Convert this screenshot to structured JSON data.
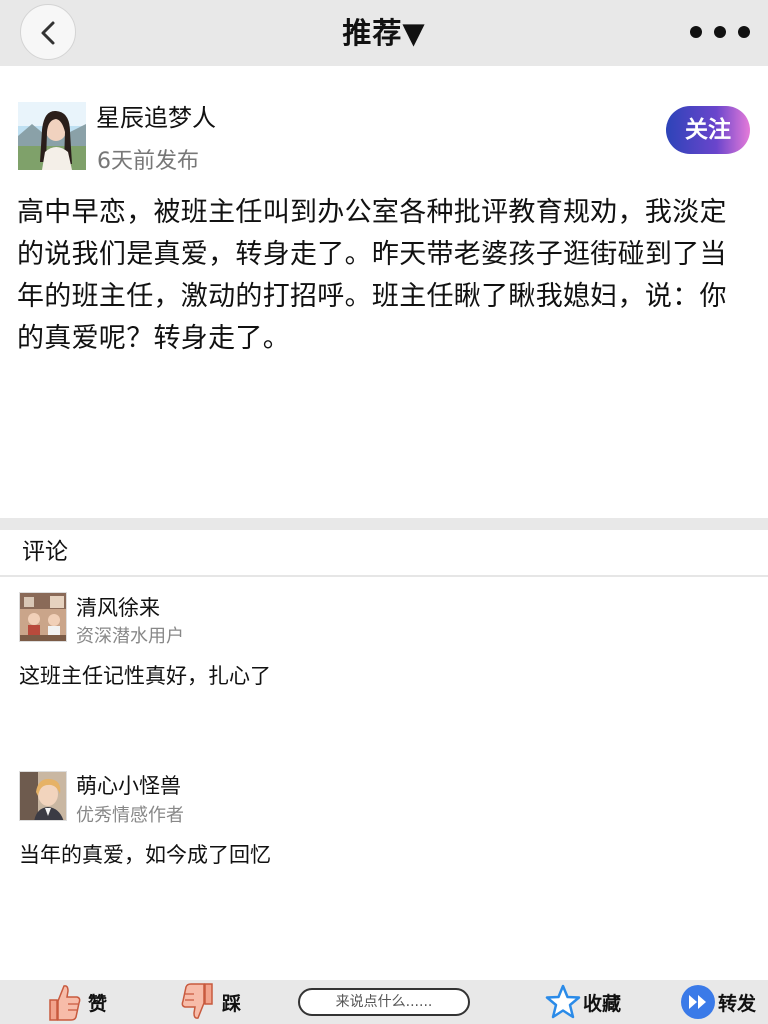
{
  "header": {
    "title": "推荐▼",
    "back_icon": "chevron-left-icon",
    "more_icon": "more-horizontal-icon"
  },
  "post": {
    "author": "星辰追梦人",
    "time": "6天前发布",
    "follow_label": "关注",
    "follow_gradient": [
      "#2d44b8",
      "#6a45cc",
      "#e57bd9"
    ],
    "body": "高中早恋，被班主任叫到办公室各种批评教育规劝，我淡定的说我们是真爱，转身走了。昨天带老婆孩子逛街碰到了当年的班主任，激动的打招呼。班主任瞅了瞅我媳妇，说：你的真爱呢？转身走了。"
  },
  "comments_section": {
    "heading": "评论",
    "items": [
      {
        "name": "清风徐来",
        "tag": "资深潜水用户",
        "text": "这班主任记性真好，扎心了"
      },
      {
        "name": "萌心小怪兽",
        "tag": "优秀情感作者",
        "text": "当年的真爱，如今成了回忆"
      }
    ]
  },
  "bottom_bar": {
    "like_label": "赞",
    "dislike_label": "踩",
    "input_placeholder": "来说点什么......",
    "favorite_label": "收藏",
    "share_label": "转发",
    "colors": {
      "like": "#f2a38c",
      "favorite": "#2b8be8",
      "share": "#3a7ae8"
    }
  }
}
